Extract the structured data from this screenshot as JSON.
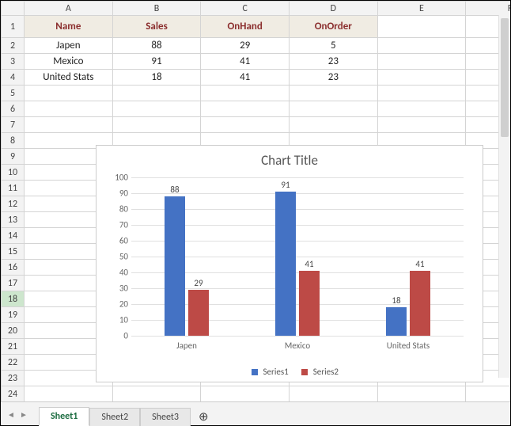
{
  "columns": [
    "A",
    "B",
    "C",
    "D",
    "E",
    "F"
  ],
  "rows": [
    1,
    2,
    3,
    4,
    5,
    6,
    7,
    8,
    9,
    10,
    11,
    12,
    13,
    14,
    15,
    16,
    17,
    18,
    19,
    20,
    21,
    22,
    23,
    24
  ],
  "table": {
    "headers": {
      "name": "Name",
      "sales": "Sales",
      "onhand": "OnHand",
      "onorder": "OnOrder"
    },
    "data": [
      {
        "name": "Japen",
        "sales": "88",
        "onhand": "29",
        "onorder": "5"
      },
      {
        "name": "Mexico",
        "sales": "91",
        "onhand": "41",
        "onorder": "23"
      },
      {
        "name": "United Stats",
        "sales": "18",
        "onhand": "41",
        "onorder": "23"
      }
    ]
  },
  "chart_data": {
    "type": "bar",
    "title": "Chart Title",
    "categories": [
      "Japen",
      "Mexico",
      "United Stats"
    ],
    "series": [
      {
        "name": "Series1",
        "values": [
          88,
          91,
          18
        ]
      },
      {
        "name": "Series2",
        "values": [
          29,
          41,
          41
        ]
      }
    ],
    "ylim": [
      0,
      100
    ],
    "yticks": [
      0,
      10,
      20,
      30,
      40,
      50,
      60,
      70,
      80,
      90,
      100
    ],
    "legend_position": "bottom",
    "xlabel": "",
    "ylabel": ""
  },
  "tabs": {
    "t1": "Sheet1",
    "t2": "Sheet2",
    "t3": "Sheet3"
  }
}
